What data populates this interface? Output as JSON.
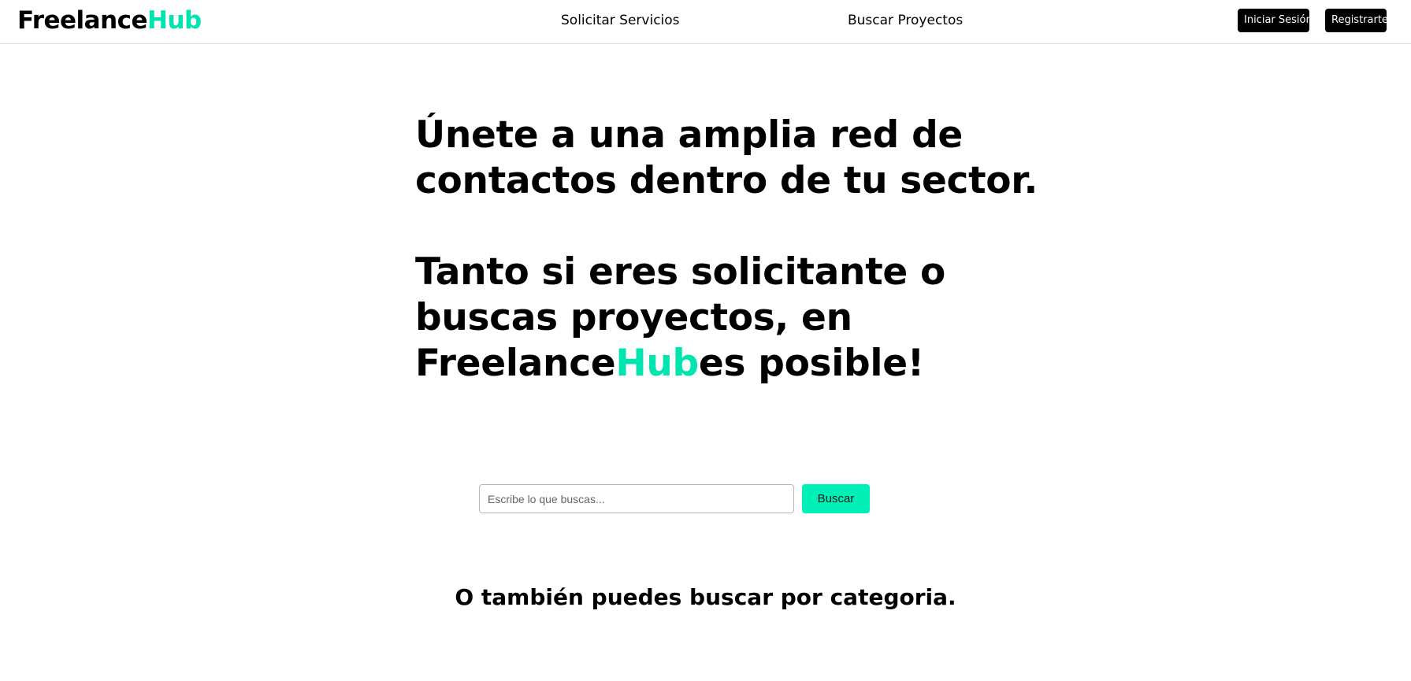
{
  "header": {
    "logo": {
      "part1": "Freelance",
      "part2": "Hub"
    },
    "nav": [
      {
        "label": "Solicitar Servicios"
      },
      {
        "label": "Buscar Proyectos"
      }
    ],
    "login_label": "Iniciar Sesión",
    "register_label": "Registrarte"
  },
  "hero": {
    "line1": "Únete a una amplia red de",
    "line2": "contactos dentro de tu sector.",
    "line3": "Tanto si eres solicitante o",
    "line4": "buscas proyectos, en",
    "line5_prefix": "Freelance",
    "line5_accent": "Hub",
    "line5_suffix": "es posible!"
  },
  "search": {
    "placeholder": "Escribe lo que buscas...",
    "value": "",
    "button_label": "Buscar"
  },
  "categories": {
    "title": "O también puedes buscar por categoria."
  },
  "colors": {
    "accent": "#00e5b0",
    "button_accent": "#00f0b8",
    "dark_button": "#000000"
  }
}
